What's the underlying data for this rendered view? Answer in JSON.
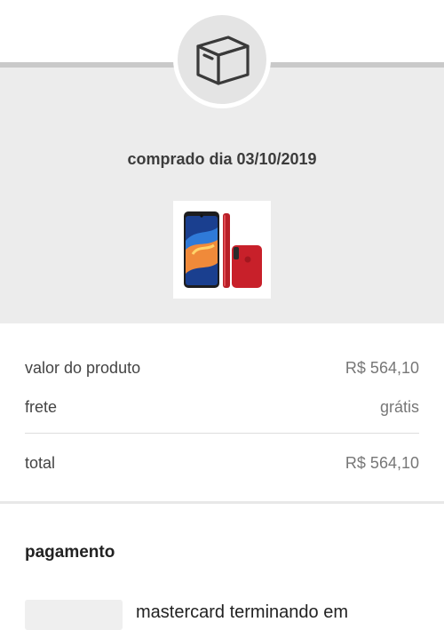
{
  "header": {
    "icon": "box-icon",
    "purchase_date": "comprado dia 03/10/2019"
  },
  "product": {
    "image": "smartphone-red"
  },
  "summary": {
    "product_value_label": "valor do produto",
    "product_value": "R$ 564,10",
    "shipping_label": "frete",
    "shipping_value": "grátis",
    "total_label": "total",
    "total_value": "R$ 564,10"
  },
  "payment": {
    "title": "pagamento",
    "card_text": "mastercard terminando em"
  },
  "colors": {
    "header_bg": "#ececec",
    "icon_bg": "#e4e4e4",
    "phone_red": "#c8202a"
  }
}
